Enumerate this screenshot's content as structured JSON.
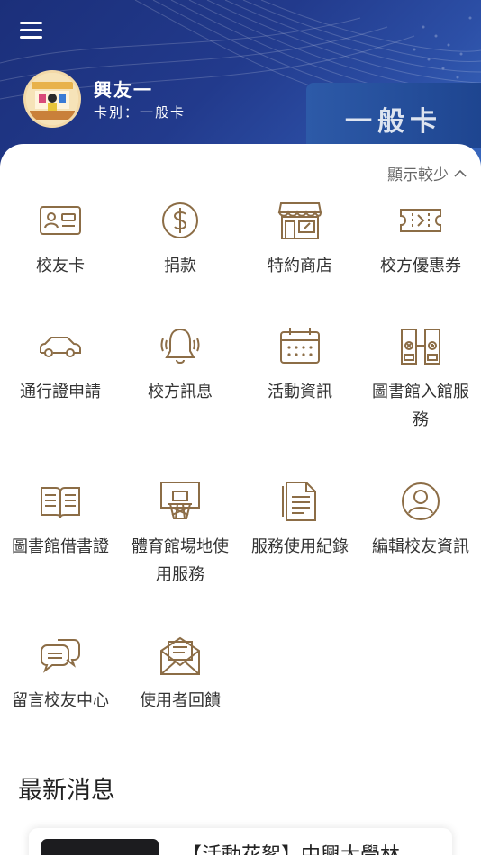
{
  "header": {
    "user_name": "興友一",
    "card_type": "卡別：一般卡",
    "card_banner": "一般卡"
  },
  "toolbar": {
    "show_less": "顯示較少"
  },
  "services": [
    {
      "label": "校友卡",
      "icon": "id-card-icon"
    },
    {
      "label": "捐款",
      "icon": "dollar-coin-icon"
    },
    {
      "label": "特約商店",
      "icon": "store-icon"
    },
    {
      "label": "校方優惠券",
      "icon": "coupon-ticket-icon"
    },
    {
      "label": "通行證申請",
      "icon": "car-icon"
    },
    {
      "label": "校方訊息",
      "icon": "bell-icon"
    },
    {
      "label": "活動資訊",
      "icon": "calendar-icon"
    },
    {
      "label": "圖書館入館服務",
      "icon": "gate-icon"
    },
    {
      "label": "圖書館借書證",
      "icon": "open-book-icon"
    },
    {
      "label": "體育館場地使用服務",
      "icon": "basketball-hoop-icon"
    },
    {
      "label": "服務使用紀錄",
      "icon": "document-list-icon"
    },
    {
      "label": "編輯校友資訊",
      "icon": "user-profile-icon"
    },
    {
      "label": "留言校友中心",
      "icon": "chat-bubbles-icon"
    },
    {
      "label": "使用者回饋",
      "icon": "envelope-letter-icon"
    }
  ],
  "news": {
    "section_title": "最新消息",
    "items": [
      {
        "headline": "【活動花絮】中興大學林"
      }
    ]
  },
  "colors": {
    "icon_gold": "#8c6d46",
    "header_blue": "#223a8c"
  }
}
